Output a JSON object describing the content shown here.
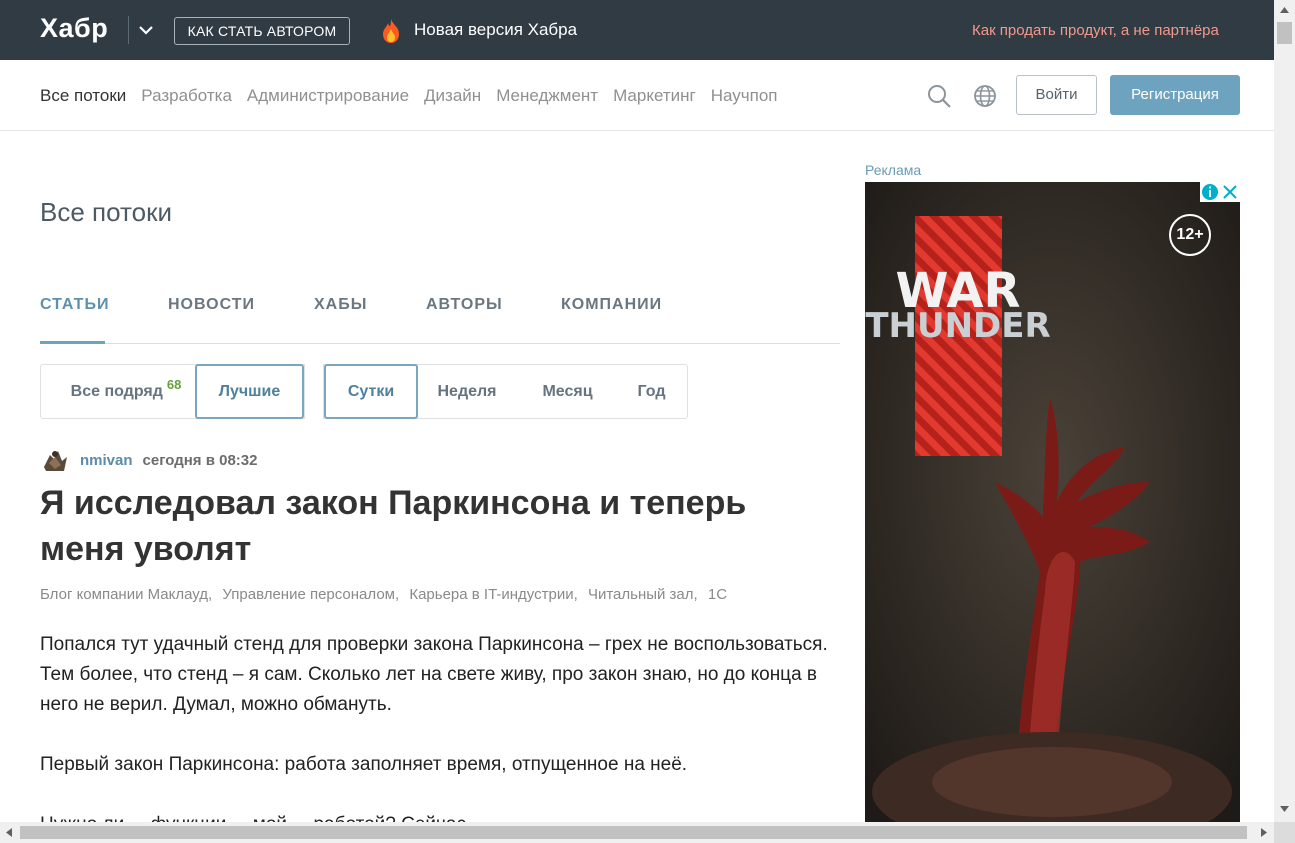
{
  "header": {
    "logo": "Хабр",
    "author_button": "КАК СТАТЬ АВТОРОМ",
    "new_version": "Новая версия Хабра",
    "promo_link": "Как продать продукт, а не партнёра",
    "icons": [
      "chevron-down-icon",
      "fire-icon"
    ]
  },
  "nav": {
    "flows": [
      {
        "label": "Все потоки",
        "active": true
      },
      {
        "label": "Разработка",
        "active": false
      },
      {
        "label": "Администрирование",
        "active": false
      },
      {
        "label": "Дизайн",
        "active": false
      },
      {
        "label": "Менеджмент",
        "active": false
      },
      {
        "label": "Маркетинг",
        "active": false
      },
      {
        "label": "Научпоп",
        "active": false
      }
    ],
    "login": "Войти",
    "signup": "Регистрация",
    "icons": [
      "search-icon",
      "globe-icon"
    ]
  },
  "main": {
    "title": "Все потоки",
    "tabs": [
      {
        "label": "СТАТЬИ",
        "active": true
      },
      {
        "label": "НОВОСТИ",
        "active": false
      },
      {
        "label": "ХАБЫ",
        "active": false
      },
      {
        "label": "АВТОРЫ",
        "active": false
      },
      {
        "label": "КОМПАНИИ",
        "active": false
      }
    ],
    "filters_sort": [
      {
        "label": "Все подряд",
        "badge": "68",
        "selected": false
      },
      {
        "label": "Лучшие",
        "selected": true
      }
    ],
    "filters_period": [
      {
        "label": "Сутки",
        "selected": true
      },
      {
        "label": "Неделя",
        "selected": false
      },
      {
        "label": "Месяц",
        "selected": false
      },
      {
        "label": "Год",
        "selected": false
      }
    ],
    "post": {
      "author": "nmivan",
      "time": "сегодня в 08:32",
      "title": "Я исследовал закон Паркинсона и теперь меня уволят",
      "hubs": [
        "Блог компании Маклауд,",
        "Управление персоналом,",
        "Карьера в IT-индустрии,",
        "Читальный зал,",
        "1С"
      ],
      "paragraphs": [
        "Попался тут удачный стенд для проверки закона Паркинсона – грех не воспользоваться. Тем более, что стенд – я сам. Сколько лет на свете живу, про закон знаю, но до конца в него не верил. Думал, можно обмануть.",
        "Первый закон Паркинсона: работа заполняет время, отпущенное на неё.",
        "Нужно ли ... функции ... мой ... работой? Сейчас ..."
      ]
    }
  },
  "ad": {
    "label": "Реклама",
    "age_rating": "12+",
    "brand_line1": "WAR",
    "brand_line2": "THUNDER",
    "colors": {
      "background": "#2b2622",
      "red_stripe": "#c42b24"
    }
  },
  "colors": {
    "topbar": "#303b44",
    "accent": "#6ea3bf",
    "promo": "#f19a8c",
    "badge_green": "#679f3f"
  }
}
